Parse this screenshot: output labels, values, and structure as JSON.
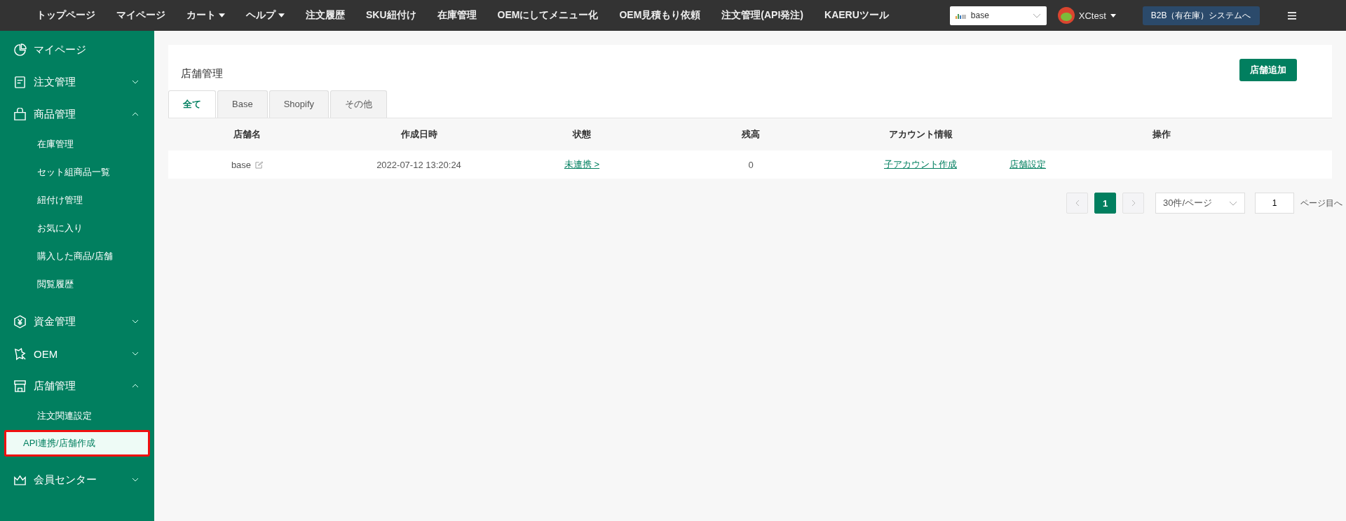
{
  "top_nav": {
    "items": [
      {
        "label": "トップページ",
        "dropdown": false
      },
      {
        "label": "マイページ",
        "dropdown": false
      },
      {
        "label": "カート",
        "dropdown": true
      },
      {
        "label": "ヘルプ",
        "dropdown": true
      },
      {
        "label": "注文履歴",
        "dropdown": false
      },
      {
        "label": "SKU紐付け",
        "dropdown": false
      },
      {
        "label": "在庫管理",
        "dropdown": false
      },
      {
        "label": "OEMにしてメニュー化",
        "dropdown": false
      },
      {
        "label": "OEM見積もり依頼",
        "dropdown": false
      },
      {
        "label": "注文管理(API発注)",
        "dropdown": false
      },
      {
        "label": "KAERUツール",
        "dropdown": false
      }
    ],
    "store_select": {
      "value": "base"
    },
    "user": {
      "name": "XCtest"
    },
    "system_button": "B2B（有在庫）システムへ"
  },
  "sidebar": {
    "items": [
      {
        "label": "マイページ",
        "kind": "pie"
      },
      {
        "label": "注文管理",
        "kind": "doc",
        "expanded": false
      },
      {
        "label": "商品管理",
        "kind": "bag",
        "expanded": true,
        "children": [
          {
            "label": "在庫管理",
            "selected": false
          },
          {
            "label": "セット組商品一覧",
            "selected": false
          },
          {
            "label": "紐付け管理",
            "selected": false
          },
          {
            "label": "お気に入り",
            "selected": false
          },
          {
            "label": "購入した商品/店舗",
            "selected": false
          },
          {
            "label": "閲覧履歴",
            "selected": false
          }
        ]
      },
      {
        "label": "資金管理",
        "kind": "yen",
        "expanded": false
      },
      {
        "label": "OEM",
        "kind": "oem",
        "expanded": false
      },
      {
        "label": "店舗管理",
        "kind": "shop",
        "expanded": true,
        "children": [
          {
            "label": "注文関連設定",
            "selected": false
          },
          {
            "label": "API連携/店舗作成",
            "selected": true
          }
        ]
      },
      {
        "label": "会員センター",
        "kind": "crown",
        "expanded": false
      }
    ]
  },
  "page": {
    "title": "店舗管理",
    "add_button": "店舗追加",
    "tabs": [
      {
        "label": "全て",
        "selected": true
      },
      {
        "label": "Base",
        "selected": false
      },
      {
        "label": "Shopify",
        "selected": false
      },
      {
        "label": "その他",
        "selected": false
      }
    ],
    "table": {
      "columns": [
        "店舗名",
        "作成日時",
        "状態",
        "残高",
        "アカウント情報",
        "操作"
      ],
      "rows": [
        {
          "store_name": "base",
          "created": "2022-07-12 13:20:24",
          "status": "未連携 >",
          "balance": "0",
          "account_link": "子アカウント作成",
          "operation_link": "店舗設定"
        }
      ]
    },
    "pagination": {
      "pages": [
        {
          "label": "1",
          "selected": true
        }
      ],
      "page_size": "30件/ページ",
      "goto_value": "1",
      "goto_suffix": "ページ目へ"
    }
  }
}
